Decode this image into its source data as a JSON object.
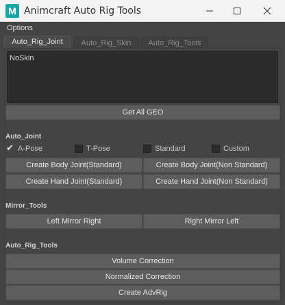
{
  "window": {
    "app_icon_letter": "M",
    "title": "Animcraft Auto Rig Tools",
    "minimize_icon": "minimize-icon",
    "maximize_icon": "maximize-icon",
    "close_icon": "close-icon"
  },
  "menu": {
    "options": "Options"
  },
  "tabs": [
    {
      "label": "Auto_Rig_Joint",
      "active": true
    },
    {
      "label": "Auto_Rig_Skin",
      "active": false
    },
    {
      "label": "Auto_Rig_Tools",
      "active": false
    }
  ],
  "geo_list": {
    "items": [
      "NoSkin"
    ]
  },
  "buttons": {
    "get_all_geo": "Get All GEO",
    "create_body_joint_standard": "Create Body Joint(Standard)",
    "create_body_joint_non_standard": "Create Body Joint(Non Standard)",
    "create_hand_joint_standard": "Create Hand Joint(Standard)",
    "create_hand_joint_non_standard": "Create Hand Joint(Non Standard)",
    "left_mirror_right": "Left Mirror Right",
    "right_mirror_left": "Right Mirror Left",
    "volume_correction": "Volume Correction",
    "normalized_correction": "Normalized Correction",
    "create_advrig": "Create AdvRig"
  },
  "sections": {
    "auto_joint": "Auto_Joint",
    "mirror_tools": "Mirror_Tools",
    "auto_rig_tools": "Auto_Rig_Tools"
  },
  "pose_options": [
    {
      "label": "A-Pose",
      "checked": true
    },
    {
      "label": "T-Pose",
      "checked": false
    },
    {
      "label": "Standard",
      "checked": false
    },
    {
      "label": "Custom",
      "checked": false
    }
  ],
  "colors": {
    "background": "#444444",
    "button": "#5d5d5d",
    "list_background": "#2b2b2b",
    "app_icon": "#17a6a6"
  }
}
